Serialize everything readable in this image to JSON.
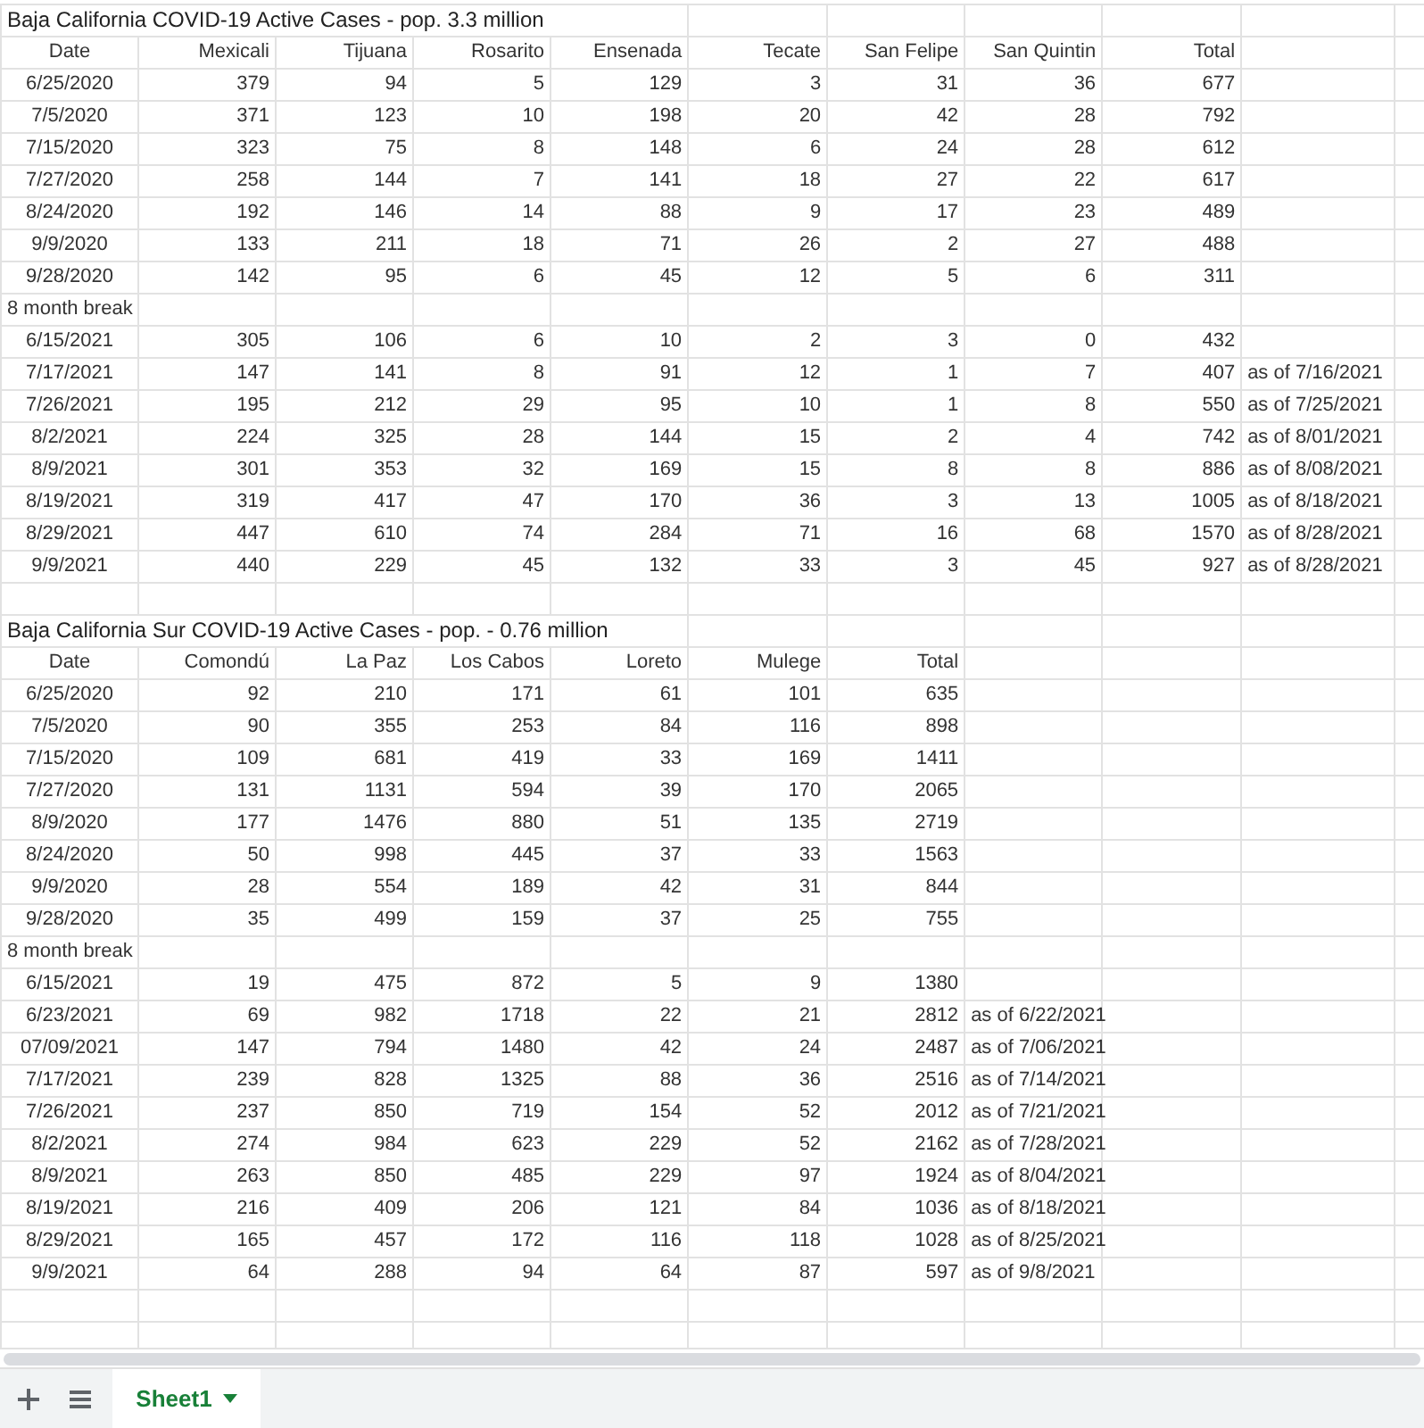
{
  "sections": [
    {
      "title": "Baja California COVID-19 Active Cases - pop. 3.3 million",
      "columns": [
        "Date",
        "Mexicali",
        "Tijuana",
        "Rosarito",
        "Ensenada",
        "Tecate",
        "San Felipe",
        "San Quintin",
        "Total"
      ],
      "rows": [
        {
          "kind": "data",
          "cells": [
            "6/25/2020",
            "379",
            "94",
            "5",
            "129",
            "3",
            "31",
            "36",
            "677"
          ]
        },
        {
          "kind": "data",
          "cells": [
            "7/5/2020",
            "371",
            "123",
            "10",
            "198",
            "20",
            "42",
            "28",
            "792"
          ]
        },
        {
          "kind": "data",
          "cells": [
            "7/15/2020",
            "323",
            "75",
            "8",
            "148",
            "6",
            "24",
            "28",
            "612"
          ]
        },
        {
          "kind": "data",
          "cells": [
            "7/27/2020",
            "258",
            "144",
            "7",
            "141",
            "18",
            "27",
            "22",
            "617"
          ]
        },
        {
          "kind": "data",
          "cells": [
            "8/24/2020",
            "192",
            "146",
            "14",
            "88",
            "9",
            "17",
            "23",
            "489"
          ]
        },
        {
          "kind": "data",
          "cells": [
            "9/9/2020",
            "133",
            "211",
            "18",
            "71",
            "26",
            "2",
            "27",
            "488"
          ]
        },
        {
          "kind": "data",
          "cells": [
            "9/28/2020",
            "142",
            "95",
            "6",
            "45",
            "12",
            "5",
            "6",
            "311"
          ]
        },
        {
          "kind": "break",
          "label": "8 month break"
        },
        {
          "kind": "data",
          "cells": [
            "6/15/2021",
            "305",
            "106",
            "6",
            "10",
            "2",
            "3",
            "0",
            "432"
          ]
        },
        {
          "kind": "data",
          "cells": [
            "7/17/2021",
            "147",
            "141",
            "8",
            "91",
            "12",
            "1",
            "7",
            "407"
          ],
          "note": "as of 7/16/2021"
        },
        {
          "kind": "data",
          "cells": [
            "7/26/2021",
            "195",
            "212",
            "29",
            "95",
            "10",
            "1",
            "8",
            "550"
          ],
          "note": "as of 7/25/2021"
        },
        {
          "kind": "data",
          "cells": [
            "8/2/2021",
            "224",
            "325",
            "28",
            "144",
            "15",
            "2",
            "4",
            "742"
          ],
          "note": "as of 8/01/2021"
        },
        {
          "kind": "data",
          "cells": [
            "8/9/2021",
            "301",
            "353",
            "32",
            "169",
            "15",
            "8",
            "8",
            "886"
          ],
          "note": "as of 8/08/2021"
        },
        {
          "kind": "data",
          "cells": [
            "8/19/2021",
            "319",
            "417",
            "47",
            "170",
            "36",
            "3",
            "13",
            "1005"
          ],
          "note": "as of 8/18/2021"
        },
        {
          "kind": "data",
          "cells": [
            "8/29/2021",
            "447",
            "610",
            "74",
            "284",
            "71",
            "16",
            "68",
            "1570"
          ],
          "note": "as of 8/28/2021"
        },
        {
          "kind": "data",
          "cells": [
            "9/9/2021",
            "440",
            "229",
            "45",
            "132",
            "33",
            "3",
            "45",
            "927"
          ],
          "note": "as of 8/28/2021"
        }
      ]
    },
    {
      "title": "Baja California Sur COVID-19 Active Cases - pop. - 0.76 million",
      "columns": [
        "Date",
        "Comondú",
        "La Paz",
        "Los Cabos",
        "Loreto",
        "Mulege",
        "Total"
      ],
      "rows": [
        {
          "kind": "data",
          "cells": [
            "6/25/2020",
            "92",
            "210",
            "171",
            "61",
            "101",
            "635"
          ]
        },
        {
          "kind": "data",
          "cells": [
            "7/5/2020",
            "90",
            "355",
            "253",
            "84",
            "116",
            "898"
          ]
        },
        {
          "kind": "data",
          "cells": [
            "7/15/2020",
            "109",
            "681",
            "419",
            "33",
            "169",
            "1411"
          ]
        },
        {
          "kind": "data",
          "cells": [
            "7/27/2020",
            "131",
            "1131",
            "594",
            "39",
            "170",
            "2065"
          ]
        },
        {
          "kind": "data",
          "cells": [
            "8/9/2020",
            "177",
            "1476",
            "880",
            "51",
            "135",
            "2719"
          ]
        },
        {
          "kind": "data",
          "cells": [
            "8/24/2020",
            "50",
            "998",
            "445",
            "37",
            "33",
            "1563"
          ]
        },
        {
          "kind": "data",
          "cells": [
            "9/9/2020",
            "28",
            "554",
            "189",
            "42",
            "31",
            "844"
          ]
        },
        {
          "kind": "data",
          "cells": [
            "9/28/2020",
            "35",
            "499",
            "159",
            "37",
            "25",
            "755"
          ]
        },
        {
          "kind": "break",
          "label": "8 month break"
        },
        {
          "kind": "data",
          "cells": [
            "6/15/2021",
            "19",
            "475",
            "872",
            "5",
            "9",
            "1380"
          ]
        },
        {
          "kind": "data",
          "cells": [
            "6/23/2021",
            "69",
            "982",
            "1718",
            "22",
            "21",
            "2812"
          ],
          "note": "as of 6/22/2021"
        },
        {
          "kind": "data",
          "cells": [
            "07/09/2021",
            "147",
            "794",
            "1480",
            "42",
            "24",
            "2487"
          ],
          "note": "as of 7/06/2021"
        },
        {
          "kind": "data",
          "cells": [
            "7/17/2021",
            "239",
            "828",
            "1325",
            "88",
            "36",
            "2516"
          ],
          "note": "as of 7/14/2021"
        },
        {
          "kind": "data",
          "cells": [
            "7/26/2021",
            "237",
            "850",
            "719",
            "154",
            "52",
            "2012"
          ],
          "note": "as of 7/21/2021"
        },
        {
          "kind": "data",
          "cells": [
            "8/2/2021",
            "274",
            "984",
            "623",
            "229",
            "52",
            "2162"
          ],
          "note": "as of 7/28/2021"
        },
        {
          "kind": "data",
          "cells": [
            "8/9/2021",
            "263",
            "850",
            "485",
            "229",
            "97",
            "1924"
          ],
          "note": "as of 8/04/2021"
        },
        {
          "kind": "data",
          "cells": [
            "8/19/2021",
            "216",
            "409",
            "206",
            "121",
            "84",
            "1036"
          ],
          "note": "as of 8/18/2021"
        },
        {
          "kind": "data",
          "cells": [
            "8/29/2021",
            "165",
            "457",
            "172",
            "116",
            "118",
            "1028"
          ],
          "note": "as of 8/25/2021"
        },
        {
          "kind": "data",
          "cells": [
            "9/9/2021",
            "64",
            "288",
            "94",
            "64",
            "87",
            "597"
          ],
          "note": "as of 9/8/2021"
        }
      ]
    }
  ],
  "sheet_tabs": [
    {
      "label": "Sheet1",
      "selected": true
    }
  ]
}
